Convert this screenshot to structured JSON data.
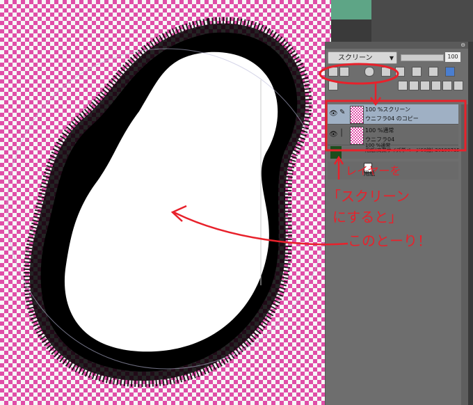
{
  "canvas": {
    "checker_color": "#e04ea8",
    "shape": "black speedline bubble (uni-flash) around white figure-eight"
  },
  "layer_panel": {
    "blend_mode": "スクリーン",
    "opacity": "100",
    "close_icon": "close-icon",
    "layers": [
      {
        "mode": "100 %スクリーン",
        "name": "ウニフラ04 のコピー",
        "selected": true
      },
      {
        "mode": "100 %通常",
        "name": "ウニフラ04",
        "selected": false
      }
    ],
    "paper_layer": {
      "mode": "100 %通常",
      "name": "用紙(商業サイズ単ページ60線) 20190715"
    },
    "text_layer": {
      "name": "用紙"
    }
  },
  "annotation": {
    "arrow_label": "レイヤーを",
    "line1": "「スクリーン",
    "line2": "にすると」",
    "line3": "このとーり！",
    "color": "#e8212b"
  }
}
